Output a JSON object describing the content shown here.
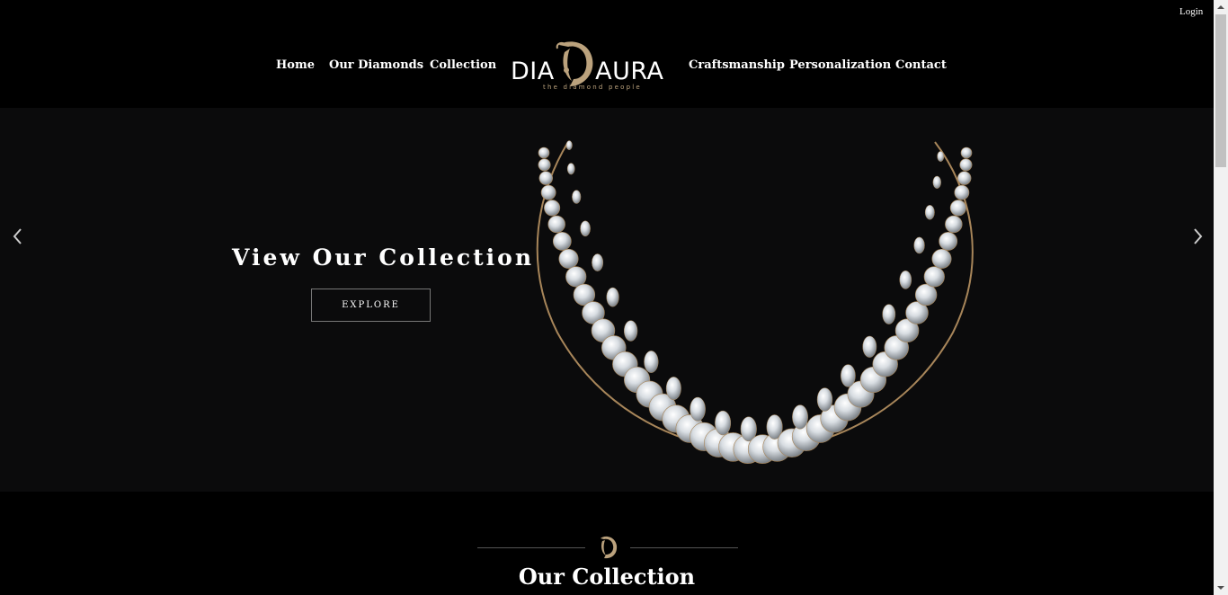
{
  "header": {
    "login_label": "Login",
    "nav_left": [
      {
        "label": "Home"
      },
      {
        "label": "Our Diamonds"
      },
      {
        "label": "Collection"
      }
    ],
    "nav_right": [
      {
        "label": "Craftsmanship"
      },
      {
        "label": "Personalization"
      },
      {
        "label": "Contact"
      }
    ],
    "logo": {
      "text": "DIADAURA",
      "tagline": "the diamond people"
    }
  },
  "hero": {
    "title": "View Our Collection",
    "button_label": "EXPLORE",
    "prev_icon": "chevron-left-icon",
    "next_icon": "chevron-right-icon",
    "image": "diamond-necklace"
  },
  "collection_section": {
    "title": "Our Collection",
    "emblem_icon": "monogram-d-icon"
  },
  "colors": {
    "background": "#000000",
    "hero_background": "#0b0b0c",
    "gold": "#bba27d",
    "text": "#ffffff"
  }
}
